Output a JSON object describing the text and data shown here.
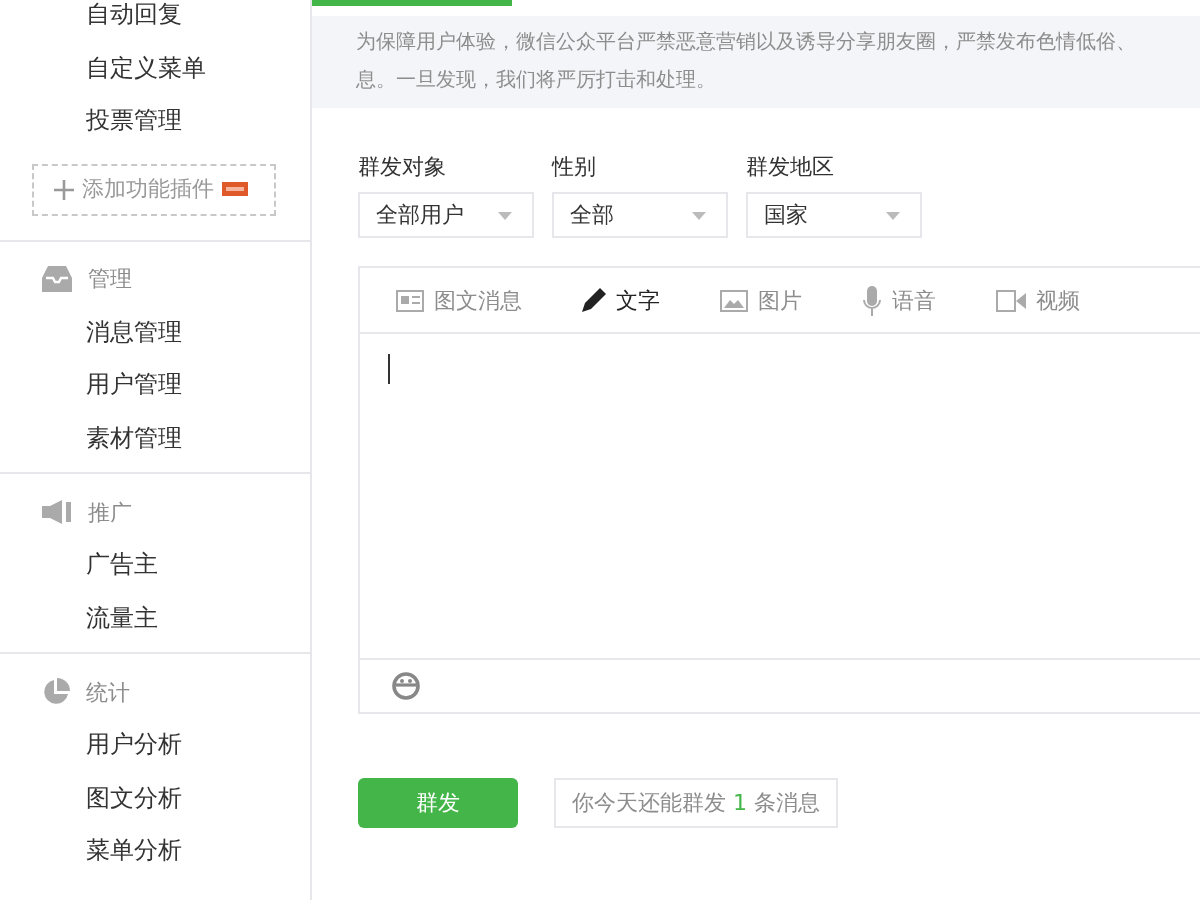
{
  "sidebar": {
    "top_items": [
      "自动回复",
      "自定义菜单",
      "投票管理"
    ],
    "add_plugin": {
      "label": "添加功能插件",
      "badge": true
    },
    "sections": [
      {
        "title": "管理",
        "items": [
          "消息管理",
          "用户管理",
          "素材管理"
        ]
      },
      {
        "title": "推广",
        "items": [
          "广告主",
          "流量主"
        ]
      },
      {
        "title": "统计",
        "items": [
          "用户分析",
          "图文分析",
          "菜单分析"
        ]
      }
    ]
  },
  "notice": [
    "为保障用户体验，微信公众平台严禁恶意营销以及诱导分享朋友圈，严禁发布色情低俗、",
    "息。一旦发现，我们将严厉打击和处理。"
  ],
  "filters": [
    {
      "label": "群发对象",
      "value": "全部用户"
    },
    {
      "label": "性别",
      "value": "全部"
    },
    {
      "label": "群发地区",
      "value": "国家"
    }
  ],
  "editor": {
    "tabs": [
      {
        "label": "图文消息",
        "selected": false
      },
      {
        "label": "文字",
        "selected": true
      },
      {
        "label": "图片",
        "selected": false
      },
      {
        "label": "语音",
        "selected": false
      },
      {
        "label": "视频",
        "selected": false
      }
    ]
  },
  "send_button": "群发",
  "tip": {
    "before": "你今天还能群发",
    "count": "1",
    "after": "条消息"
  }
}
